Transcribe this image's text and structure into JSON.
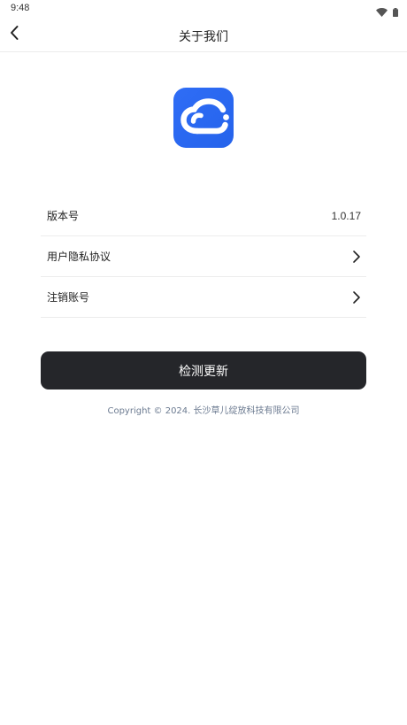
{
  "status_bar": {
    "time": "9:48",
    "icons": [
      "wifi-icon",
      "battery-icon"
    ]
  },
  "header": {
    "title": "关于我们",
    "back_icon": "chevron-left-icon"
  },
  "logo": {
    "icon": "cloud-icon",
    "color": "#2f6df6"
  },
  "info_list": {
    "items": [
      {
        "label": "版本号",
        "value": "1.0.17"
      },
      {
        "label": "用户隐私协议",
        "icon": "chevron-right-icon"
      },
      {
        "label": "注销账号",
        "icon": "chevron-right-icon"
      }
    ]
  },
  "actions": {
    "check_update_label": "检测更新",
    "button_color": "#25262a"
  },
  "footer": {
    "copyright": "Copyright © 2024. 长沙草儿绽放科技有限公司"
  }
}
